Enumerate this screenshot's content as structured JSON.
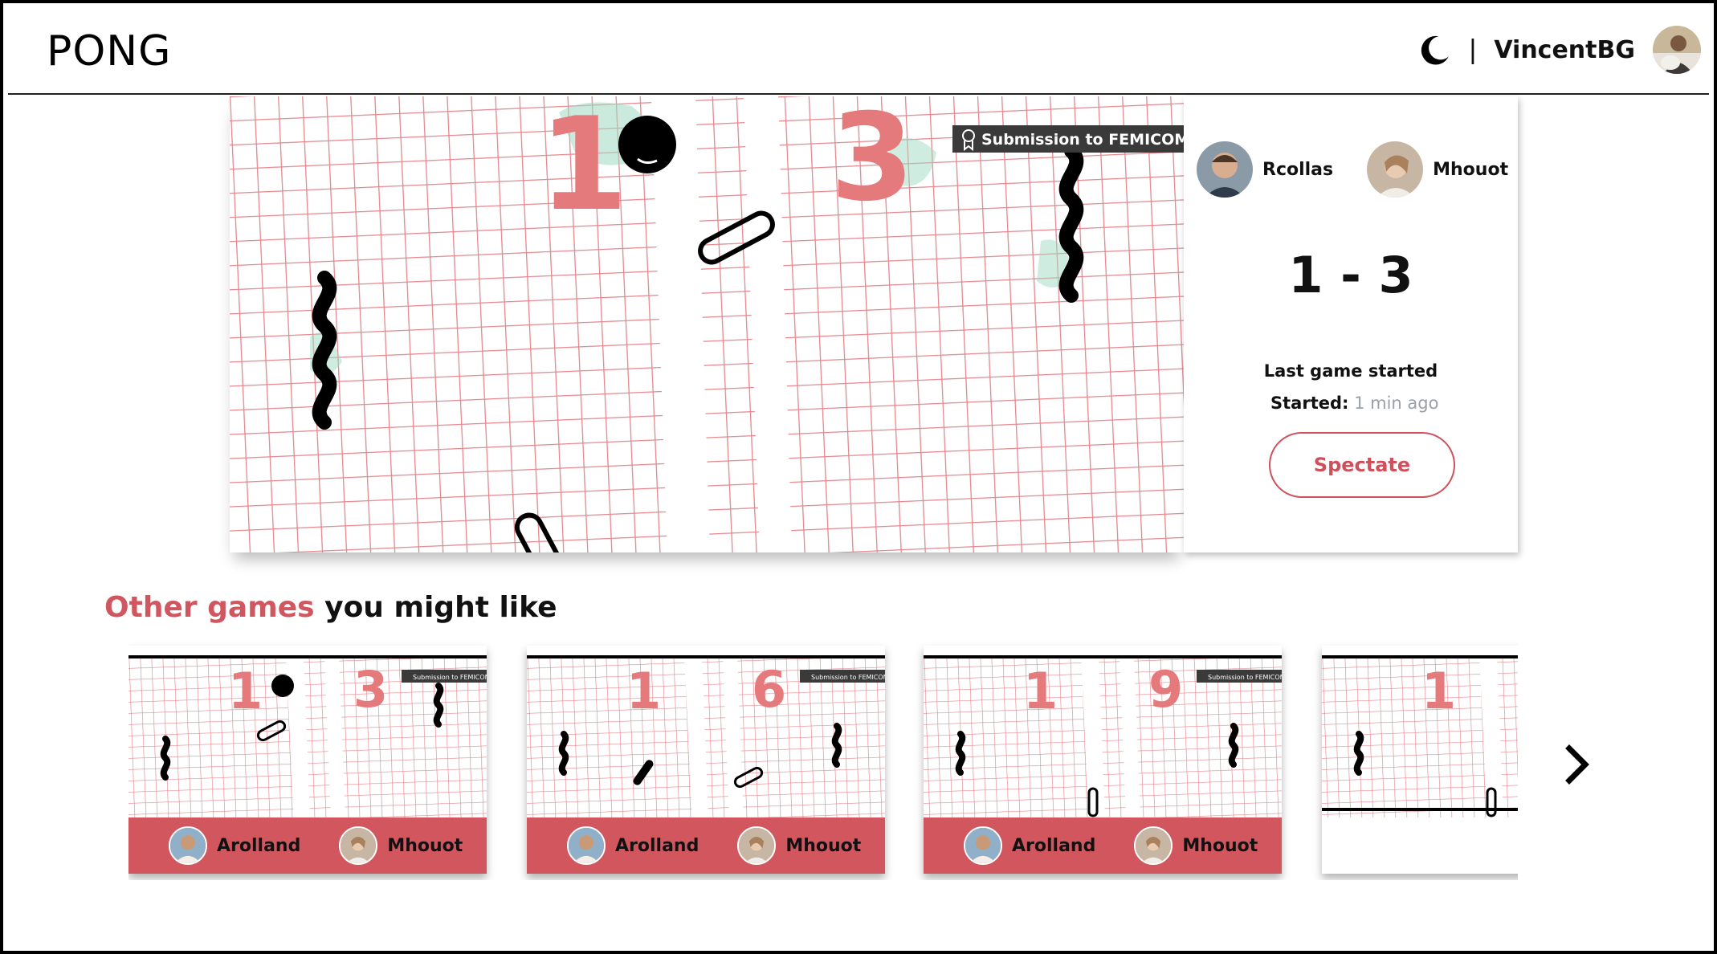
{
  "header": {
    "logo": "PONG",
    "separator": "|",
    "username": "VincentBG",
    "theme_icon": "moon-icon"
  },
  "current_game": {
    "score_left": "1",
    "score_right": "3",
    "banner": "Submission to FEMICOM Ga",
    "player1": "Rcollas",
    "player2": "Mhouot",
    "score": "1 - 3",
    "status": "Last game started",
    "started_label": "Started:",
    "started_value": "1 min ago",
    "spectate_label": "Spectate"
  },
  "other_games": {
    "title_accent": "Other games",
    "title_rest": " you might like",
    "cards": [
      {
        "score_left": "1",
        "score_right": "3",
        "player1": "Arolland",
        "player2": "Mhouot"
      },
      {
        "score_left": "1",
        "score_right": "6",
        "player1": "Arolland",
        "player2": "Mhouot"
      },
      {
        "score_left": "1",
        "score_right": "9",
        "player1": "Arolland",
        "player2": "Mhouot"
      },
      {
        "score_left": "1",
        "score_right": ""
      }
    ],
    "banner": "Submission to FEMICOM Ga"
  },
  "colors": {
    "accent": "#d0575f",
    "grid": "#e3878e",
    "score_digits": "#e57a7c"
  }
}
